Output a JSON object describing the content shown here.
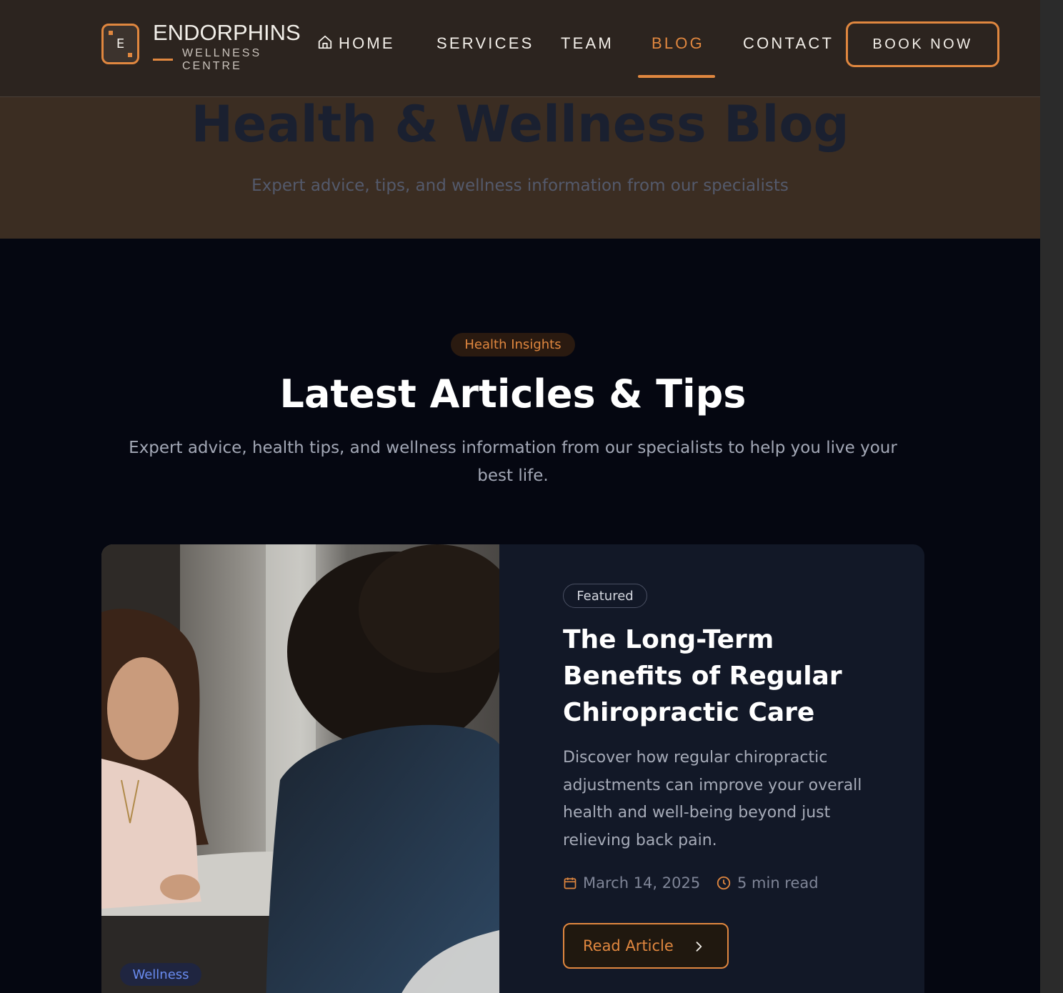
{
  "brand": {
    "name": "ENDORPHINS",
    "tagline": "WELLNESS CENTRE",
    "monogram": "E",
    "accent_color": "#e0873f"
  },
  "nav": {
    "items": [
      {
        "label": "HOME",
        "icon": "home-icon"
      },
      {
        "label": "SERVICES"
      },
      {
        "label": "TEAM"
      },
      {
        "label": "BLOG",
        "active": true
      },
      {
        "label": "CONTACT"
      }
    ],
    "cta": "BOOK NOW"
  },
  "hero": {
    "title": "Health & Wellness Blog",
    "subtitle": "Expert advice, tips, and wellness information from our specialists"
  },
  "section": {
    "badge": "Health Insights",
    "title": "Latest Articles & Tips",
    "subtitle": "Expert advice, health tips, and wellness information from our specialists to help you live your best life."
  },
  "featured_article": {
    "badge": "Featured",
    "category": "Wellness",
    "title": "The Long-Term Benefits of Regular Chiropractic Care",
    "excerpt": "Discover how regular chiropractic adjustments can improve your overall health and well-being beyond just relieving back pain.",
    "date": "March 14, 2025",
    "read_time": "5 min read",
    "cta": "Read Article",
    "image_icon": "consultation-photo"
  }
}
